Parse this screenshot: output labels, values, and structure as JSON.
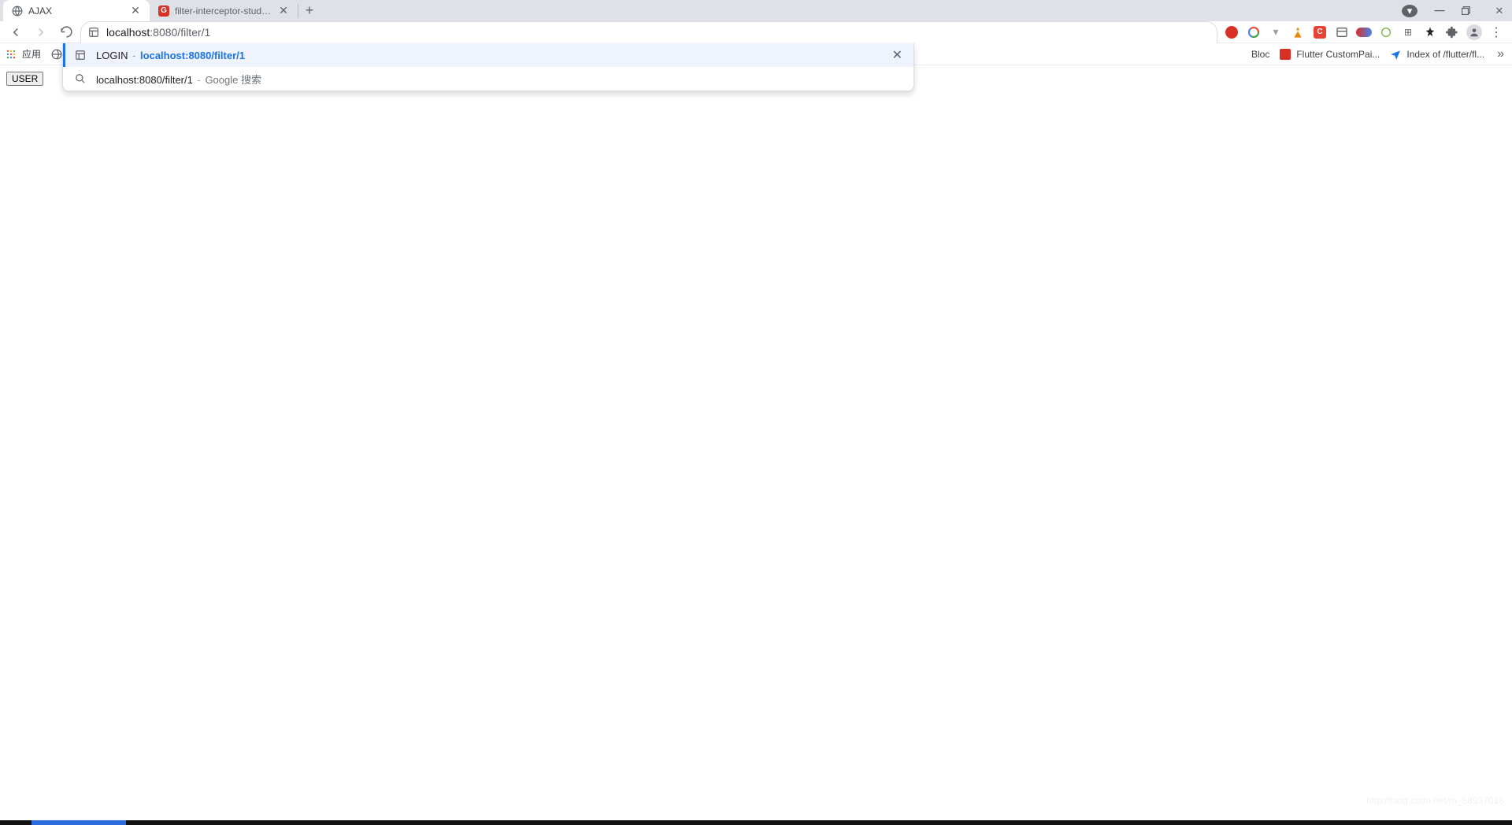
{
  "tabs": [
    {
      "title": "AJAX",
      "favicon": "globe"
    },
    {
      "title": "filter-interceptor-study: filter-i",
      "favicon": "red-g"
    }
  ],
  "address": {
    "host": "localhost",
    "rest": ":8080/filter/1"
  },
  "suggestions": [
    {
      "title": "LOGIN",
      "url": "localhost:8080/filter/1",
      "icon": "page"
    },
    {
      "query": "localhost:8080/filter/1",
      "engine": "Google 搜索",
      "icon": "search"
    }
  ],
  "bookmarks": {
    "apps": "应用",
    "items": [
      {
        "label": "Bloc",
        "icon": ""
      },
      {
        "label": "Flutter CustomPai...",
        "icon": "red"
      },
      {
        "label": "Index of /flutter/fl...",
        "icon": "arrow"
      }
    ]
  },
  "page": {
    "button": "USER"
  },
  "watermark": "http://blog.csdn.net/m_58937018"
}
